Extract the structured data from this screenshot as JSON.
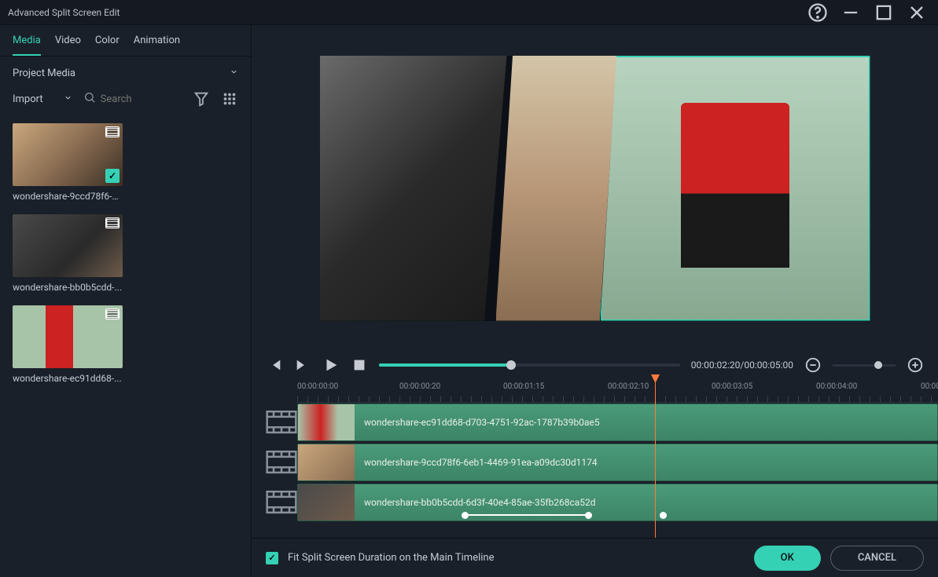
{
  "window": {
    "title": "Advanced Split Screen Edit"
  },
  "tabs": [
    "Media",
    "Video",
    "Color",
    "Animation"
  ],
  "source_dropdown": "Project Media",
  "import_label": "Import",
  "search_placeholder": "Search",
  "media_items": [
    {
      "name": "wondershare-9ccd78f6-6...",
      "checked": true
    },
    {
      "name": "wondershare-bb0b5cdd-...",
      "checked": false
    },
    {
      "name": "wondershare-ec91dd68-...",
      "checked": false
    }
  ],
  "play_time": "00:00:02:20/00:00:05:00",
  "ruler_ticks": [
    "00:00:00:00",
    "00:00:00:20",
    "00:00:01:15",
    "00:00:02:10",
    "00:00:03:05",
    "00:00:04:00",
    "00:00:0"
  ],
  "tracks": [
    {
      "name": "wondershare-ec91dd68-d703-4751-92ac-1787b39b0ae5"
    },
    {
      "name": "wondershare-9ccd78f6-6eb1-4469-91ea-a09dc30d1174"
    },
    {
      "name": "wondershare-bb0b5cdd-6d3f-40e4-85ae-35fb268ca52d"
    }
  ],
  "footer": {
    "fit_label": "Fit Split Screen Duration on the Main Timeline",
    "ok": "OK",
    "cancel": "CANCEL"
  }
}
